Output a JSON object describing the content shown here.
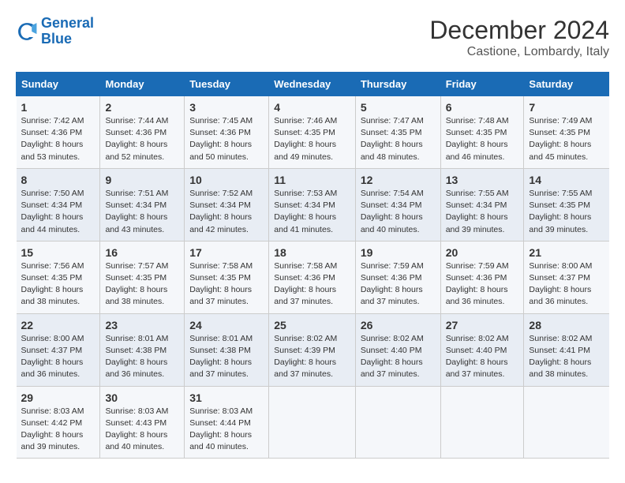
{
  "header": {
    "logo_line1": "General",
    "logo_line2": "Blue",
    "month_year": "December 2024",
    "location": "Castione, Lombardy, Italy"
  },
  "weekdays": [
    "Sunday",
    "Monday",
    "Tuesday",
    "Wednesday",
    "Thursday",
    "Friday",
    "Saturday"
  ],
  "weeks": [
    [
      {
        "day": "1",
        "sunrise": "Sunrise: 7:42 AM",
        "sunset": "Sunset: 4:36 PM",
        "daylight": "Daylight: 8 hours and 53 minutes."
      },
      {
        "day": "2",
        "sunrise": "Sunrise: 7:44 AM",
        "sunset": "Sunset: 4:36 PM",
        "daylight": "Daylight: 8 hours and 52 minutes."
      },
      {
        "day": "3",
        "sunrise": "Sunrise: 7:45 AM",
        "sunset": "Sunset: 4:36 PM",
        "daylight": "Daylight: 8 hours and 50 minutes."
      },
      {
        "day": "4",
        "sunrise": "Sunrise: 7:46 AM",
        "sunset": "Sunset: 4:35 PM",
        "daylight": "Daylight: 8 hours and 49 minutes."
      },
      {
        "day": "5",
        "sunrise": "Sunrise: 7:47 AM",
        "sunset": "Sunset: 4:35 PM",
        "daylight": "Daylight: 8 hours and 48 minutes."
      },
      {
        "day": "6",
        "sunrise": "Sunrise: 7:48 AM",
        "sunset": "Sunset: 4:35 PM",
        "daylight": "Daylight: 8 hours and 46 minutes."
      },
      {
        "day": "7",
        "sunrise": "Sunrise: 7:49 AM",
        "sunset": "Sunset: 4:35 PM",
        "daylight": "Daylight: 8 hours and 45 minutes."
      }
    ],
    [
      {
        "day": "8",
        "sunrise": "Sunrise: 7:50 AM",
        "sunset": "Sunset: 4:34 PM",
        "daylight": "Daylight: 8 hours and 44 minutes."
      },
      {
        "day": "9",
        "sunrise": "Sunrise: 7:51 AM",
        "sunset": "Sunset: 4:34 PM",
        "daylight": "Daylight: 8 hours and 43 minutes."
      },
      {
        "day": "10",
        "sunrise": "Sunrise: 7:52 AM",
        "sunset": "Sunset: 4:34 PM",
        "daylight": "Daylight: 8 hours and 42 minutes."
      },
      {
        "day": "11",
        "sunrise": "Sunrise: 7:53 AM",
        "sunset": "Sunset: 4:34 PM",
        "daylight": "Daylight: 8 hours and 41 minutes."
      },
      {
        "day": "12",
        "sunrise": "Sunrise: 7:54 AM",
        "sunset": "Sunset: 4:34 PM",
        "daylight": "Daylight: 8 hours and 40 minutes."
      },
      {
        "day": "13",
        "sunrise": "Sunrise: 7:55 AM",
        "sunset": "Sunset: 4:34 PM",
        "daylight": "Daylight: 8 hours and 39 minutes."
      },
      {
        "day": "14",
        "sunrise": "Sunrise: 7:55 AM",
        "sunset": "Sunset: 4:35 PM",
        "daylight": "Daylight: 8 hours and 39 minutes."
      }
    ],
    [
      {
        "day": "15",
        "sunrise": "Sunrise: 7:56 AM",
        "sunset": "Sunset: 4:35 PM",
        "daylight": "Daylight: 8 hours and 38 minutes."
      },
      {
        "day": "16",
        "sunrise": "Sunrise: 7:57 AM",
        "sunset": "Sunset: 4:35 PM",
        "daylight": "Daylight: 8 hours and 38 minutes."
      },
      {
        "day": "17",
        "sunrise": "Sunrise: 7:58 AM",
        "sunset": "Sunset: 4:35 PM",
        "daylight": "Daylight: 8 hours and 37 minutes."
      },
      {
        "day": "18",
        "sunrise": "Sunrise: 7:58 AM",
        "sunset": "Sunset: 4:36 PM",
        "daylight": "Daylight: 8 hours and 37 minutes."
      },
      {
        "day": "19",
        "sunrise": "Sunrise: 7:59 AM",
        "sunset": "Sunset: 4:36 PM",
        "daylight": "Daylight: 8 hours and 37 minutes."
      },
      {
        "day": "20",
        "sunrise": "Sunrise: 7:59 AM",
        "sunset": "Sunset: 4:36 PM",
        "daylight": "Daylight: 8 hours and 36 minutes."
      },
      {
        "day": "21",
        "sunrise": "Sunrise: 8:00 AM",
        "sunset": "Sunset: 4:37 PM",
        "daylight": "Daylight: 8 hours and 36 minutes."
      }
    ],
    [
      {
        "day": "22",
        "sunrise": "Sunrise: 8:00 AM",
        "sunset": "Sunset: 4:37 PM",
        "daylight": "Daylight: 8 hours and 36 minutes."
      },
      {
        "day": "23",
        "sunrise": "Sunrise: 8:01 AM",
        "sunset": "Sunset: 4:38 PM",
        "daylight": "Daylight: 8 hours and 36 minutes."
      },
      {
        "day": "24",
        "sunrise": "Sunrise: 8:01 AM",
        "sunset": "Sunset: 4:38 PM",
        "daylight": "Daylight: 8 hours and 37 minutes."
      },
      {
        "day": "25",
        "sunrise": "Sunrise: 8:02 AM",
        "sunset": "Sunset: 4:39 PM",
        "daylight": "Daylight: 8 hours and 37 minutes."
      },
      {
        "day": "26",
        "sunrise": "Sunrise: 8:02 AM",
        "sunset": "Sunset: 4:40 PM",
        "daylight": "Daylight: 8 hours and 37 minutes."
      },
      {
        "day": "27",
        "sunrise": "Sunrise: 8:02 AM",
        "sunset": "Sunset: 4:40 PM",
        "daylight": "Daylight: 8 hours and 37 minutes."
      },
      {
        "day": "28",
        "sunrise": "Sunrise: 8:02 AM",
        "sunset": "Sunset: 4:41 PM",
        "daylight": "Daylight: 8 hours and 38 minutes."
      }
    ],
    [
      {
        "day": "29",
        "sunrise": "Sunrise: 8:03 AM",
        "sunset": "Sunset: 4:42 PM",
        "daylight": "Daylight: 8 hours and 39 minutes."
      },
      {
        "day": "30",
        "sunrise": "Sunrise: 8:03 AM",
        "sunset": "Sunset: 4:43 PM",
        "daylight": "Daylight: 8 hours and 40 minutes."
      },
      {
        "day": "31",
        "sunrise": "Sunrise: 8:03 AM",
        "sunset": "Sunset: 4:44 PM",
        "daylight": "Daylight: 8 hours and 40 minutes."
      },
      null,
      null,
      null,
      null
    ]
  ]
}
